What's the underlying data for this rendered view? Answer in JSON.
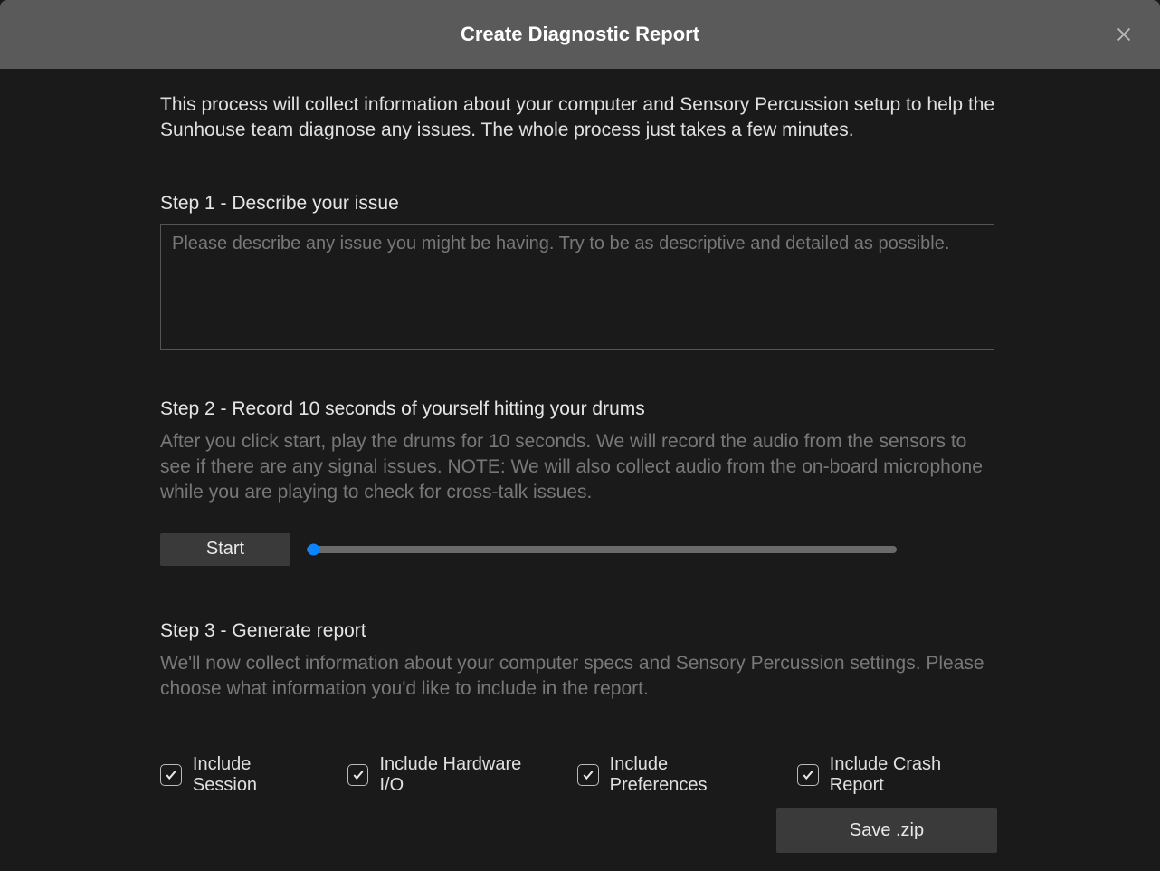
{
  "header": {
    "title": "Create Diagnostic Report"
  },
  "intro": "This process will collect information about your computer and Sensory Percussion setup to help the Sunhouse team diagnose any issues. The whole process just takes a few minutes.",
  "step1": {
    "title": "Step 1 - Describe your issue",
    "placeholder": "Please describe any issue you might be having. Try to be as descriptive and detailed as possible."
  },
  "step2": {
    "title": "Step 2 - Record 10 seconds of yourself hitting your drums",
    "desc": "After you click start, play the drums for 10 seconds. We will record the audio from the sensors to see if there are any signal issues. NOTE: We will also collect audio from the on-board microphone while you are playing to check for cross-talk issues.",
    "start_label": "Start"
  },
  "step3": {
    "title": "Step 3 - Generate report",
    "desc": "We'll now collect information about your computer specs and Sensory Percussion settings. Please choose what information you'd like to include in the report.",
    "checkboxes": [
      {
        "label": "Include Session",
        "checked": true
      },
      {
        "label": "Include Hardware I/O",
        "checked": true
      },
      {
        "label": "Include Preferences",
        "checked": true
      },
      {
        "label": "Include Crash Report",
        "checked": true
      }
    ]
  },
  "footer": {
    "save_label": "Save .zip"
  }
}
